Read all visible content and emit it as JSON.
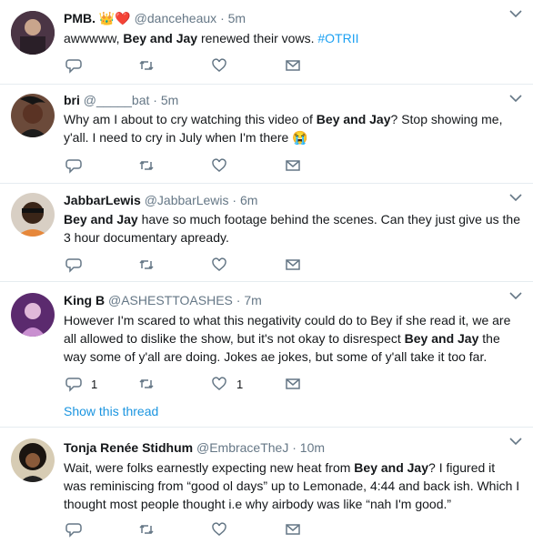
{
  "tweets": [
    {
      "name": "PMB.",
      "badges": [
        "👑",
        "❤️"
      ],
      "handle": "@danceheaux",
      "time": "5m",
      "text_parts": [
        "awwwww, ",
        "Bey and Jay",
        " renewed their vows. ",
        "#OTRII"
      ],
      "reply_count": "",
      "like_count": ""
    },
    {
      "name": "bri",
      "handle": "@_____bat",
      "time": "5m",
      "text_parts": [
        "Why am I about to cry watching this video of ",
        "Bey and Jay",
        "? Stop showing me, y'all. I need to cry in July when I'm there ",
        "😭"
      ],
      "reply_count": "",
      "like_count": ""
    },
    {
      "name": "JabbarLewis",
      "handle": "@JabbarLewis",
      "time": "6m",
      "text_parts": [
        "Bey and Jay",
        " have so much footage behind the scenes. Can they just give us the 3 hour documentary apready."
      ],
      "reply_count": "",
      "like_count": ""
    },
    {
      "name": "King B",
      "handle": "@ASHESTTOASHES",
      "time": "7m",
      "text_parts": [
        "However I'm scared to what this negativity could do to Bey if she read it, we are all allowed to dislike the show, but it's not okay to disrespect ",
        "Bey and Jay",
        " the way some of y'all are doing. Jokes ae jokes, but some of y'all take it too far."
      ],
      "reply_count": "1",
      "like_count": "1",
      "show_thread": "Show this thread"
    },
    {
      "name": "Tonja Renée Stidhum",
      "handle": "@EmbraceTheJ",
      "time": "10m",
      "text_parts": [
        "Wait, were folks earnestly expecting new heat from ",
        "Bey and Jay",
        "? I figured it was reminiscing from “good ol days” up to Lemonade, 4:44 and back ish. Which I thought most people thought i.e why airbody was like “nah I'm good.”"
      ],
      "reply_count": "",
      "like_count": ""
    }
  ],
  "separator": "·",
  "icons": {
    "reply": "reply-icon",
    "retweet": "retweet-icon",
    "like": "heart-icon",
    "dm": "envelope-icon",
    "more": "chevron-down-icon"
  },
  "colors": {
    "link": "#1da1f2",
    "muted": "#657786",
    "text": "#14171a"
  }
}
